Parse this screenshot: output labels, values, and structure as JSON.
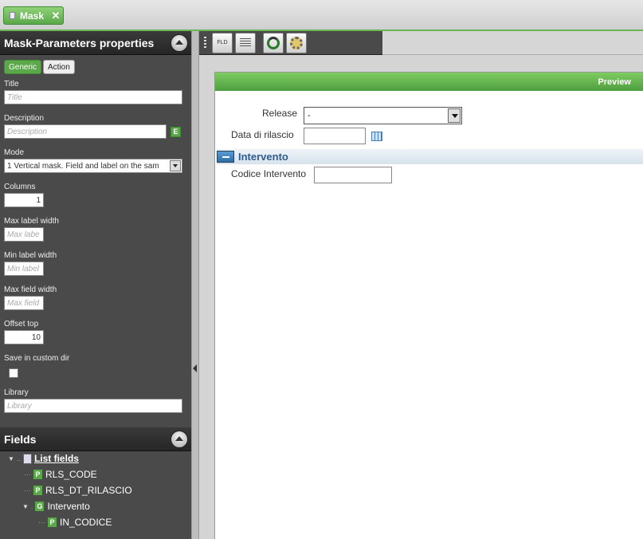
{
  "top_tab": {
    "label": "Mask"
  },
  "properties_panel": {
    "title": "Mask-Parameters properties",
    "tabs": [
      {
        "label": "Generic"
      },
      {
        "label": "Action"
      }
    ],
    "fields": {
      "title": {
        "label": "Title",
        "placeholder": "Title"
      },
      "description": {
        "label": "Description",
        "placeholder": "Description",
        "button": "E"
      },
      "mode": {
        "label": "Mode",
        "value": "1 Vertical mask. Field and label on the sam"
      },
      "columns": {
        "label": "Columns",
        "value": "1"
      },
      "max_label_width": {
        "label": "Max label width",
        "placeholder": "Max labe"
      },
      "min_label_width": {
        "label": "Min label width",
        "placeholder": "Min label"
      },
      "max_field_width": {
        "label": "Max field width",
        "placeholder": "Max field"
      },
      "offset_top": {
        "label": "Offset top",
        "value": "10"
      },
      "save_custom_dir": {
        "label": "Save in custom dir",
        "checked": false
      },
      "library": {
        "label": "Library",
        "placeholder": "Library"
      }
    }
  },
  "fields_panel": {
    "title": "Fields",
    "tree": {
      "root": "List fields",
      "items": [
        {
          "type": "P",
          "label": "RLS_CODE"
        },
        {
          "type": "P",
          "label": "RLS_DT_RILASCIO"
        },
        {
          "type": "G",
          "label": "Intervento"
        },
        {
          "type": "P",
          "label": "IN_CODICE"
        }
      ]
    }
  },
  "toolbar": {
    "buttons": [
      {
        "icon": "fld-icon",
        "text": "FLD"
      },
      {
        "icon": "list-icon"
      },
      {
        "icon": "refresh-icon"
      },
      {
        "icon": "settings-icon"
      }
    ]
  },
  "preview": {
    "header": "Preview",
    "release_label": "Release",
    "release_value": "-",
    "date_label": "Data di rilascio",
    "group_title": "Intervento",
    "code_label": "Codice Intervento"
  },
  "colors": {
    "accent_green": "#5aa84a",
    "panel_dark": "#4a4a4a",
    "group_blue": "#2f5c8e"
  }
}
